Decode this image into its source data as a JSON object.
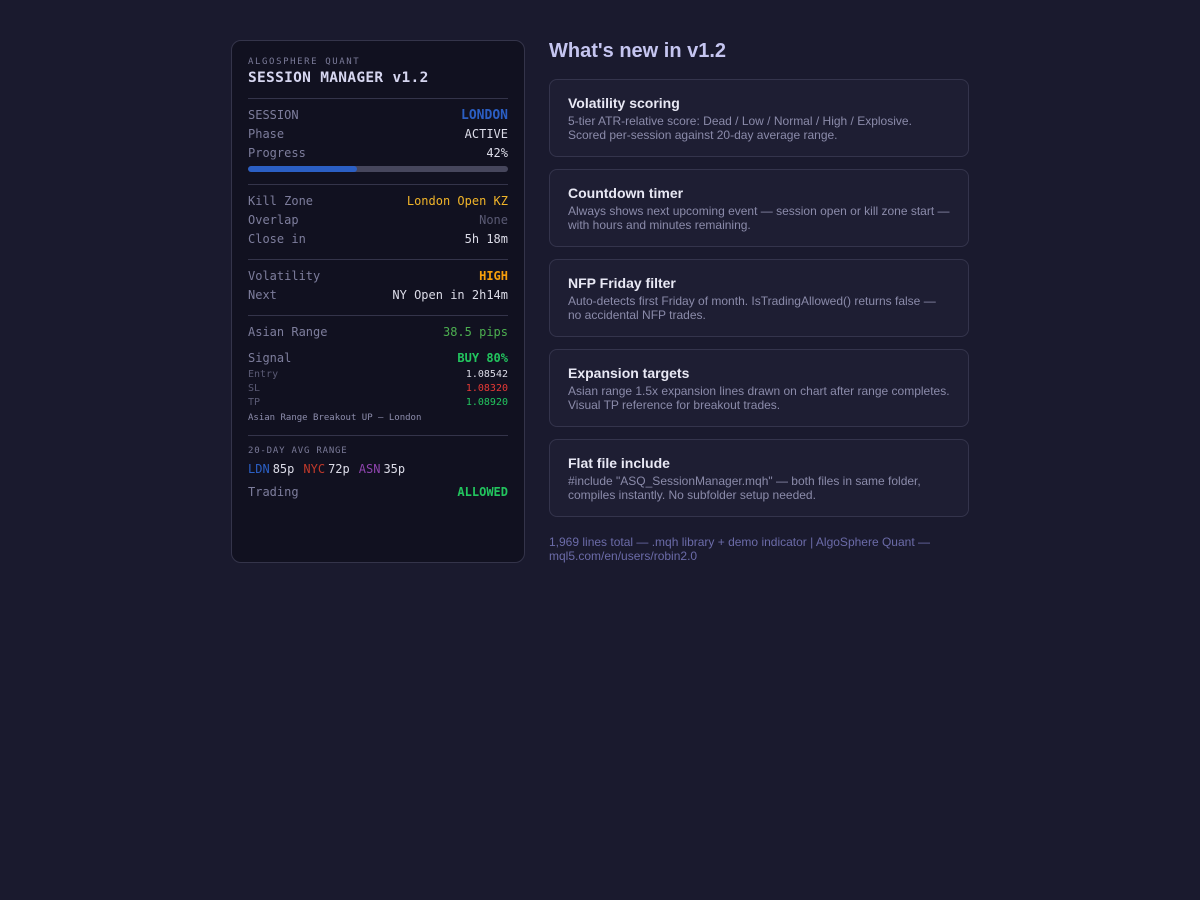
{
  "panel": {
    "brand": "ALGOSPHERE QUANT",
    "title": "SESSION MANAGER v1.2",
    "session": {
      "label": "SESSION",
      "value": "LONDON",
      "color": "#2b5fc4"
    },
    "phase": {
      "label": "Phase",
      "value": "ACTIVE"
    },
    "progress": {
      "label": "Progress",
      "value": "42%",
      "fraction": 0.42,
      "color": "#2b5fc4"
    },
    "kill_zone": {
      "label": "Kill Zone",
      "value": "London Open KZ",
      "color": "#f0b429"
    },
    "overlap": {
      "label": "Overlap",
      "value": "None"
    },
    "close_in": {
      "label": "Close in",
      "value": "5h 18m"
    },
    "volatility": {
      "label": "Volatility",
      "value": "HIGH",
      "color": "#f59e0b"
    },
    "next": {
      "label": "Next",
      "value": "NY Open in 2h14m"
    },
    "asian_range": {
      "label": "Asian Range",
      "value": "38.5 pips",
      "color": "#4caf50"
    },
    "signal": {
      "label": "Signal",
      "value": "BUY 80%",
      "color": "#22c55e"
    },
    "entry": {
      "label": "Entry",
      "value": "1.08542"
    },
    "sl": {
      "label": "SL",
      "value": "1.08320",
      "color": "#e53935"
    },
    "tp": {
      "label": "TP",
      "value": "1.08920",
      "color": "#22c55e"
    },
    "signal_note": "Asian Range Breakout UP — London",
    "avg_range": {
      "label": "20-DAY AVG RANGE",
      "items": [
        {
          "name": "LDN",
          "value": "85p",
          "color": "#2b5fc4"
        },
        {
          "name": "NYC",
          "value": "72p",
          "color": "#c0392b"
        },
        {
          "name": "ASN",
          "value": "35p",
          "color": "#8e44ad"
        }
      ]
    },
    "trading": {
      "label": "Trading",
      "value": "ALLOWED",
      "color": "#22c55e"
    }
  },
  "whats_new": {
    "heading": "What's new in v1.2",
    "cards": [
      {
        "title": "Volatility scoring",
        "desc": "5-tier ATR-relative score: Dead / Low / Normal / High / Explosive. Scored per-session against 20-day average range."
      },
      {
        "title": "Countdown timer",
        "desc": "Always shows next upcoming event — session open or kill zone start — with hours and minutes remaining."
      },
      {
        "title": "NFP Friday filter",
        "desc": "Auto-detects first Friday of month. IsTradingAllowed() returns false — no accidental NFP trades."
      },
      {
        "title": "Expansion targets",
        "desc": "Asian range 1.5x expansion lines drawn on chart after range completes. Visual TP reference for breakout trades."
      },
      {
        "title": "Flat file include",
        "desc": "#include \"ASQ_SessionManager.mqh\" — both files in same folder, compiles instantly. No subfolder setup needed."
      }
    ],
    "footer": "1,969 lines total — .mqh library + demo indicator | AlgoSphere Quant — mql5.com/en/users/robin2.0"
  }
}
